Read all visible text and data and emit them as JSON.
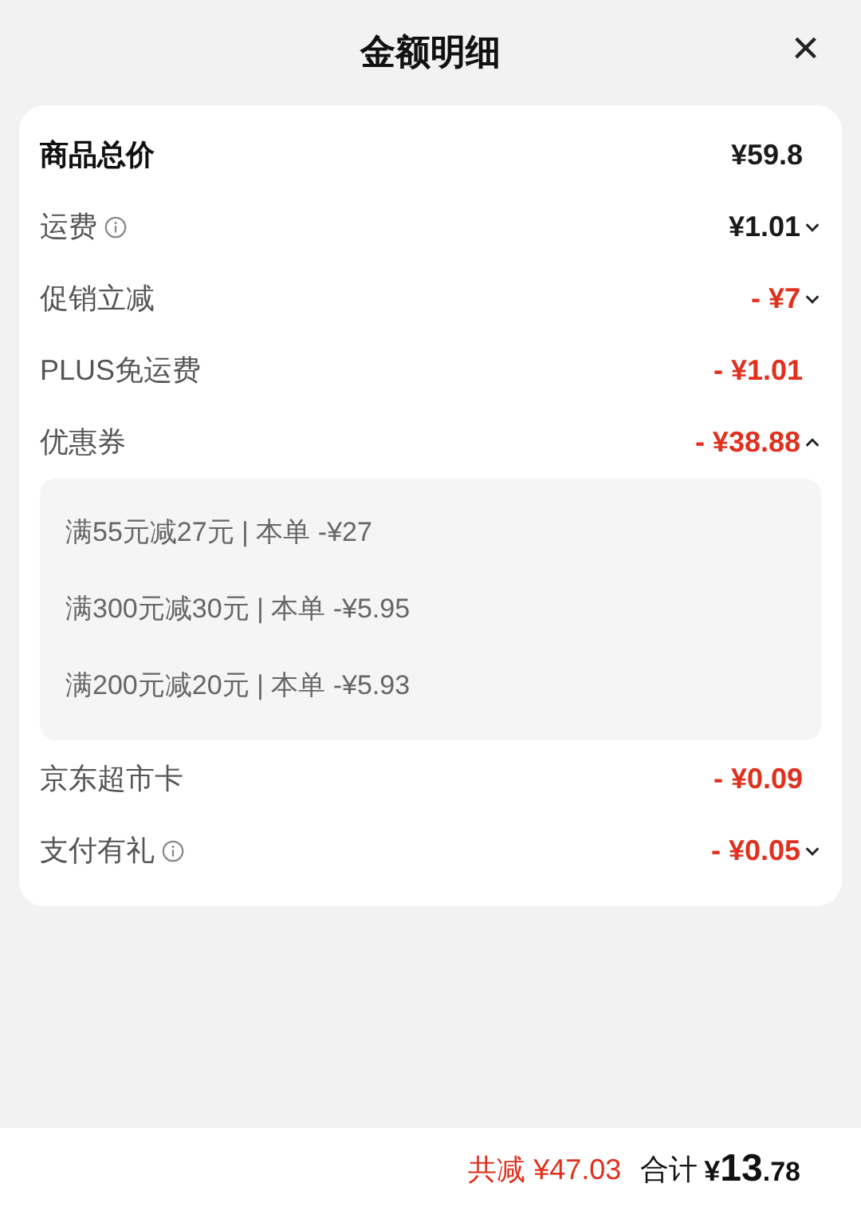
{
  "header": {
    "title": "金额明细",
    "close_label": "×"
  },
  "rows": [
    {
      "kind": "total",
      "label": "商品总价",
      "value": "¥59.8"
    },
    {
      "kind": "charge",
      "label": "运费",
      "value": "¥1.01",
      "info": true,
      "expanded": false
    },
    {
      "kind": "discount",
      "label": "促销立减",
      "value": "- ¥7",
      "expanded": false
    },
    {
      "kind": "discount",
      "label": "PLUS免运费",
      "value": "- ¥1.01"
    },
    {
      "kind": "discount",
      "label": "优惠券",
      "value": "- ¥38.88",
      "expanded": true,
      "details": [
        "满55元减27元 | 本单 -¥27",
        "满300元减30元 | 本单 -¥5.95",
        "满200元减20元 | 本单 -¥5.93"
      ]
    },
    {
      "kind": "discount",
      "label": "京东超市卡",
      "value": "- ¥0.09"
    },
    {
      "kind": "discount",
      "label": "支付有礼",
      "value": "- ¥0.05",
      "info": true,
      "expanded": false
    }
  ],
  "footer": {
    "saved": "共减 ¥47.03",
    "total_label": "合计",
    "total_currency": "¥",
    "total_whole": "13",
    "total_fraction": ".78"
  }
}
